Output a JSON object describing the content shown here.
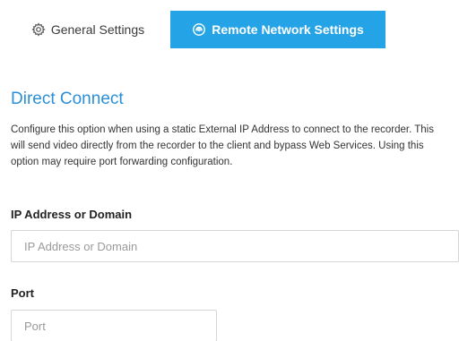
{
  "tabs": {
    "general": {
      "label": "General Settings",
      "icon": "gear-icon"
    },
    "remote": {
      "label": "Remote Network Settings",
      "icon": "network-icon",
      "active": true
    }
  },
  "direct_connect": {
    "title": "Direct Connect",
    "description": "Configure this option when using a static External IP Address to connect to the recorder. This will send video directly from the recorder to the client and bypass Web Services. Using this option may require port forwarding configuration."
  },
  "ip_field": {
    "label": "IP Address or Domain",
    "placeholder": "IP Address or Domain",
    "value": ""
  },
  "port_field": {
    "label": "Port",
    "placeholder": "Port",
    "value": ""
  },
  "colors": {
    "accent": "#24a3e6",
    "title": "#2b8fd6"
  }
}
